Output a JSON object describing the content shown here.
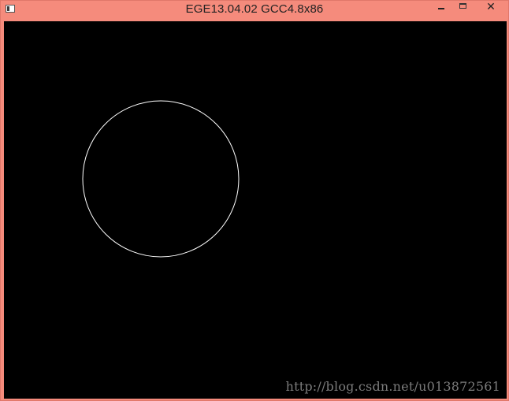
{
  "window": {
    "title": "EGE13.04.02 GCC4.8x86",
    "controls": {
      "minimize_icon": "minimize-icon",
      "maximize_icon": "maximize-icon",
      "close_glyph": "✕"
    },
    "colors": {
      "titlebar": "#f58b7c",
      "canvas_background": "#000000",
      "circle_stroke": "#ffffff"
    }
  },
  "canvas": {
    "shapes": [
      {
        "type": "circle",
        "stroke": "#ffffff",
        "fill": "none"
      }
    ],
    "watermark": "http://blog.csdn.net/u013872561"
  }
}
